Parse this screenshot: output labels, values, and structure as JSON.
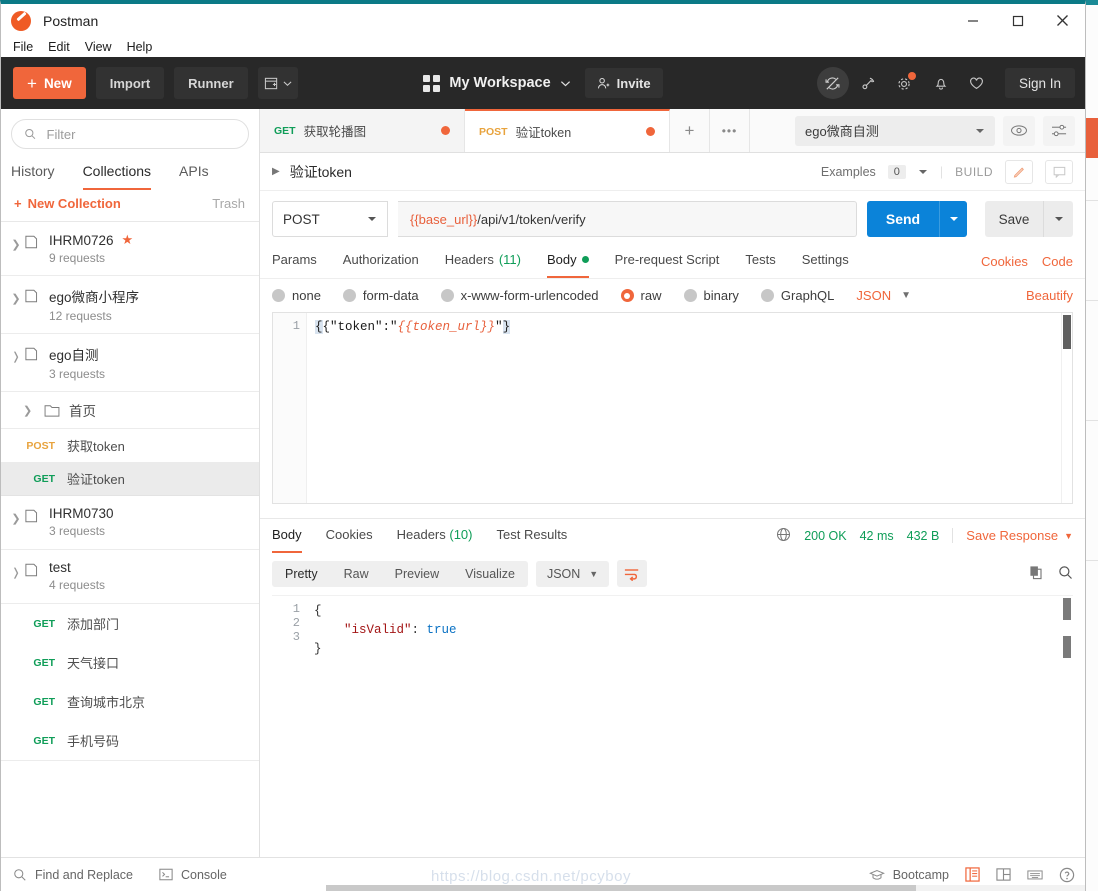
{
  "window": {
    "app_title": "Postman",
    "controls": {
      "minimize": "minimize-icon",
      "maximize": "maximize-icon",
      "close": "close-icon"
    }
  },
  "menubar": {
    "items": [
      "File",
      "Edit",
      "View",
      "Help"
    ]
  },
  "toolbar": {
    "new_label": "New",
    "import_label": "Import",
    "runner_label": "Runner",
    "workspace_label": "My Workspace",
    "invite_label": "Invite",
    "signin_label": "Sign In",
    "icons": [
      "sync-disabled-icon",
      "satellite-icon",
      "gear-icon",
      "bell-icon",
      "heart-icon"
    ]
  },
  "sidebar": {
    "filter_placeholder": "Filter",
    "tabs": [
      {
        "label": "History",
        "active": false
      },
      {
        "label": "Collections",
        "active": true
      },
      {
        "label": "APIs",
        "active": false
      }
    ],
    "new_collection_label": "New Collection",
    "trash_label": "Trash",
    "collections": [
      {
        "name": "IHRM0726",
        "count": "9 requests",
        "starred": true,
        "expanded": false
      },
      {
        "name": "ego微商小程序",
        "count": "12 requests",
        "starred": false,
        "expanded": false
      },
      {
        "name": "ego自测",
        "count": "3 requests",
        "starred": false,
        "expanded": true
      },
      {
        "name": "IHRM0730",
        "count": "3 requests",
        "starred": false,
        "expanded": false
      },
      {
        "name": "test",
        "count": "4 requests",
        "starred": false,
        "expanded": true
      }
    ],
    "ego_children": {
      "folder": "首页",
      "requests": [
        {
          "method": "POST",
          "name": "获取token",
          "selected": false
        },
        {
          "method": "GET",
          "name": "验证token",
          "selected": true
        }
      ]
    },
    "test_children": {
      "requests": [
        {
          "method": "GET",
          "name": "添加部门"
        },
        {
          "method": "GET",
          "name": "天气接口"
        },
        {
          "method": "GET",
          "name": "查询城市北京"
        },
        {
          "method": "GET",
          "name": "手机号码"
        }
      ]
    }
  },
  "tabstrip": {
    "tabs": [
      {
        "method": "GET",
        "name": "获取轮播图",
        "active": false,
        "unsaved": true
      },
      {
        "method": "POST",
        "name": "验证token",
        "active": true,
        "unsaved": true
      }
    ],
    "add_tab": "+",
    "more_tabs": "•••",
    "environment": "ego微商自测",
    "env_icons": [
      "eye-icon",
      "sliders-icon"
    ]
  },
  "request_header": {
    "title": "验证token",
    "examples_label": "Examples",
    "examples_count": "0",
    "build_label": "BUILD"
  },
  "request": {
    "method": "POST",
    "url_variable": "{{base_url}}",
    "url_path": "/api/v1/token/verify",
    "send_label": "Send",
    "save_label": "Save",
    "tabs": [
      {
        "label": "Params",
        "active": false
      },
      {
        "label": "Authorization",
        "active": false
      },
      {
        "label": "Headers",
        "count": "(11)",
        "active": false
      },
      {
        "label": "Body",
        "active": true,
        "dot": true
      },
      {
        "label": "Pre-request Script",
        "active": false
      },
      {
        "label": "Tests",
        "active": false
      },
      {
        "label": "Settings",
        "active": false
      }
    ],
    "cookies_label": "Cookies",
    "code_label": "Code",
    "body_types": [
      {
        "label": "none",
        "selected": false
      },
      {
        "label": "form-data",
        "selected": false
      },
      {
        "label": "x-www-form-urlencoded",
        "selected": false
      },
      {
        "label": "raw",
        "selected": true
      },
      {
        "label": "binary",
        "selected": false
      },
      {
        "label": "GraphQL",
        "selected": false
      }
    ],
    "raw_format": "JSON",
    "beautify_label": "Beautify",
    "body_line_number": "1",
    "body_prefix": "{\"token\":\"",
    "body_variable": "{{token_url}}",
    "body_suffix": "\"}"
  },
  "response": {
    "tabs": [
      {
        "label": "Body",
        "active": true
      },
      {
        "label": "Cookies",
        "active": false
      },
      {
        "label": "Headers",
        "count": "(10)",
        "active": false
      },
      {
        "label": "Test Results",
        "active": false
      }
    ],
    "status": "200 OK",
    "time": "42 ms",
    "size": "432 B",
    "save_response_label": "Save Response",
    "view_modes": [
      {
        "label": "Pretty",
        "active": true
      },
      {
        "label": "Raw",
        "active": false
      },
      {
        "label": "Preview",
        "active": false
      },
      {
        "label": "Visualize",
        "active": false
      }
    ],
    "format": "JSON",
    "icons": [
      "wrap-text-icon",
      "copy-icon",
      "search-icon"
    ],
    "lines": [
      {
        "n": "1",
        "text": "{"
      },
      {
        "n": "2",
        "key": "\"isValid\"",
        "sep": ": ",
        "value": "true"
      },
      {
        "n": "3",
        "text": "}"
      }
    ]
  },
  "statusbar": {
    "find_replace_label": "Find and Replace",
    "console_label": "Console",
    "bootcamp_label": "Bootcamp",
    "right_icons": [
      "two-pane-icon",
      "layout-icon",
      "keyboard-icon",
      "help-icon"
    ],
    "watermark": "https://blog.csdn.net/pcyboy"
  }
}
